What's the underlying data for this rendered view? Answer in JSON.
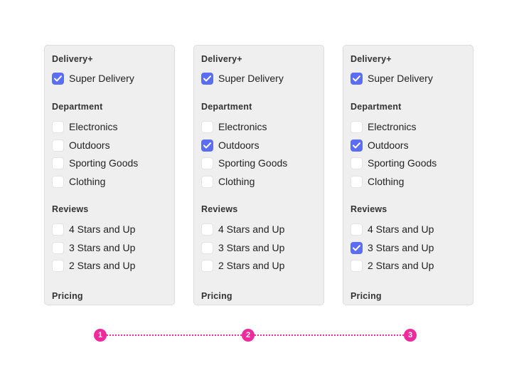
{
  "accent_color": "#5b6cf5",
  "step_color": "#ee2a9c",
  "panels": [
    {
      "delivery": {
        "title": "Delivery+",
        "options": [
          {
            "label": "Super Delivery",
            "checked": true
          }
        ]
      },
      "department": {
        "title": "Department",
        "options": [
          {
            "label": "Electronics",
            "checked": false
          },
          {
            "label": "Outdoors",
            "checked": false
          },
          {
            "label": "Sporting Goods",
            "checked": false
          },
          {
            "label": "Clothing",
            "checked": false
          }
        ]
      },
      "reviews": {
        "title": "Reviews",
        "options": [
          {
            "label": "4 Stars and Up",
            "checked": false
          },
          {
            "label": "3 Stars and Up",
            "checked": false
          },
          {
            "label": "2 Stars and Up",
            "checked": false
          }
        ]
      },
      "pricing": {
        "title": "Pricing"
      }
    },
    {
      "delivery": {
        "title": "Delivery+",
        "options": [
          {
            "label": "Super Delivery",
            "checked": true
          }
        ]
      },
      "department": {
        "title": "Department",
        "options": [
          {
            "label": "Electronics",
            "checked": false
          },
          {
            "label": "Outdoors",
            "checked": true
          },
          {
            "label": "Sporting Goods",
            "checked": false
          },
          {
            "label": "Clothing",
            "checked": false
          }
        ]
      },
      "reviews": {
        "title": "Reviews",
        "options": [
          {
            "label": "4 Stars and Up",
            "checked": false
          },
          {
            "label": "3 Stars and Up",
            "checked": false
          },
          {
            "label": "2 Stars and Up",
            "checked": false
          }
        ]
      },
      "pricing": {
        "title": "Pricing"
      }
    },
    {
      "delivery": {
        "title": "Delivery+",
        "options": [
          {
            "label": "Super Delivery",
            "checked": true
          }
        ]
      },
      "department": {
        "title": "Department",
        "options": [
          {
            "label": "Electronics",
            "checked": false
          },
          {
            "label": "Outdoors",
            "checked": true
          },
          {
            "label": "Sporting Goods",
            "checked": false
          },
          {
            "label": "Clothing",
            "checked": false
          }
        ]
      },
      "reviews": {
        "title": "Reviews",
        "options": [
          {
            "label": "4 Stars and Up",
            "checked": false
          },
          {
            "label": "3 Stars and Up",
            "checked": true
          },
          {
            "label": "2 Stars and Up",
            "checked": false
          }
        ]
      },
      "pricing": {
        "title": "Pricing"
      }
    }
  ],
  "steps": [
    "1",
    "2",
    "3"
  ]
}
